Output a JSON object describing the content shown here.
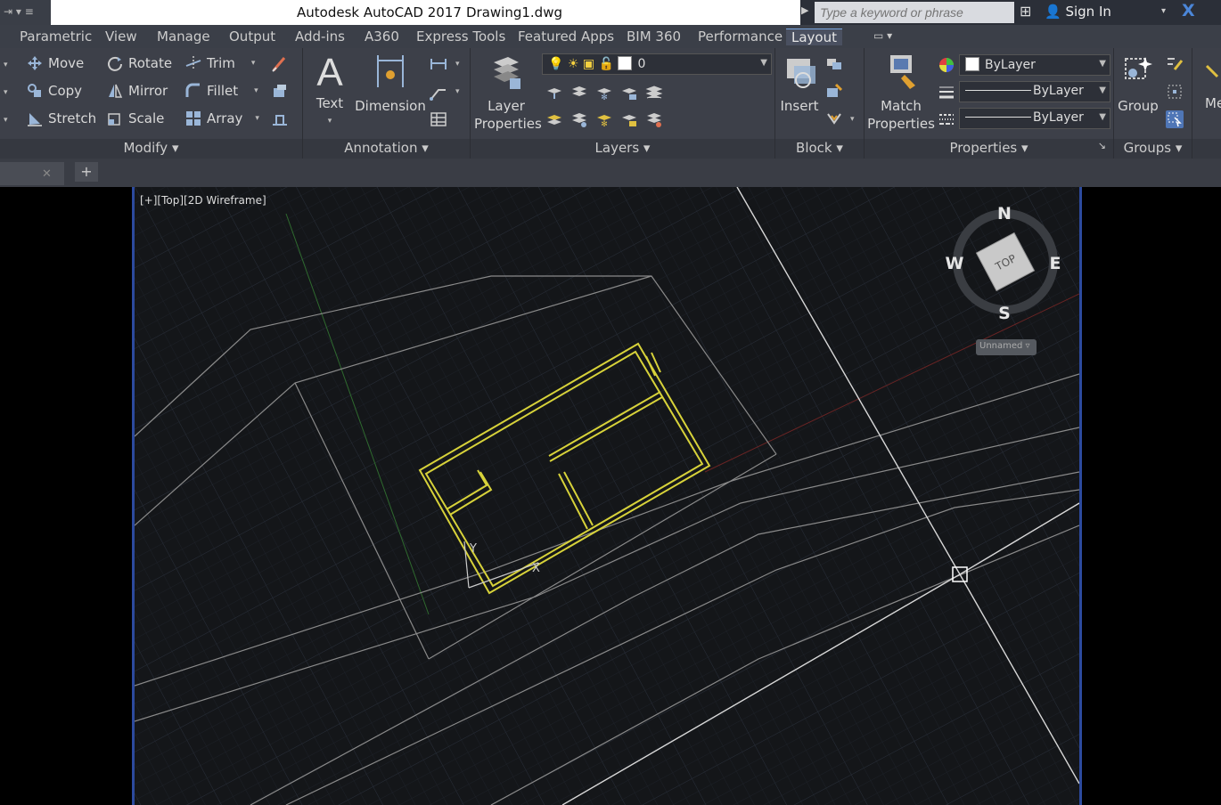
{
  "titlebar": {
    "app_title": "Autodesk AutoCAD 2017",
    "file_name": "Drawing1.dwg",
    "search_placeholder": "Type a keyword or phrase",
    "sign_in": "Sign In"
  },
  "tabs": [
    "Parametric",
    "View",
    "Manage",
    "Output",
    "Add-ins",
    "A360",
    "Express Tools",
    "Featured Apps",
    "BIM 360",
    "Performance",
    "Layout"
  ],
  "active_tab": "Layout",
  "ribbon": {
    "modify": {
      "title": "Modify",
      "move": "Move",
      "copy": "Copy",
      "stretch": "Stretch",
      "rotate": "Rotate",
      "mirror": "Mirror",
      "scale": "Scale",
      "trim": "Trim",
      "fillet": "Fillet",
      "array": "Array"
    },
    "annotation": {
      "title": "Annotation",
      "text": "Text",
      "dimension": "Dimension"
    },
    "layers": {
      "title": "Layers",
      "layer_properties_1": "Layer",
      "layer_properties_2": "Properties",
      "current_layer": "0"
    },
    "block": {
      "title": "Block",
      "insert": "Insert"
    },
    "properties": {
      "title": "Properties",
      "match_1": "Match",
      "match_2": "Properties",
      "color": "ByLayer",
      "linetype": "ByLayer",
      "lineweight": "ByLayer"
    },
    "groups": {
      "title": "Groups",
      "group": "Group"
    },
    "next_panel_partial": "Me"
  },
  "viewport": {
    "label": "[+][Top][2D Wireframe]",
    "viewcube": {
      "north": "N",
      "south": "S",
      "east": "E",
      "west": "W",
      "face": "TOP",
      "ucs_label": "Unnamed"
    },
    "ucs_x": "X",
    "ucs_y": "Y"
  },
  "colors": {
    "background": "#141619",
    "wall_color": "#d7d23a",
    "grid_color": "#252a33",
    "line_color": "#9a9a9a",
    "viewport_border": "#2c4a9e"
  }
}
